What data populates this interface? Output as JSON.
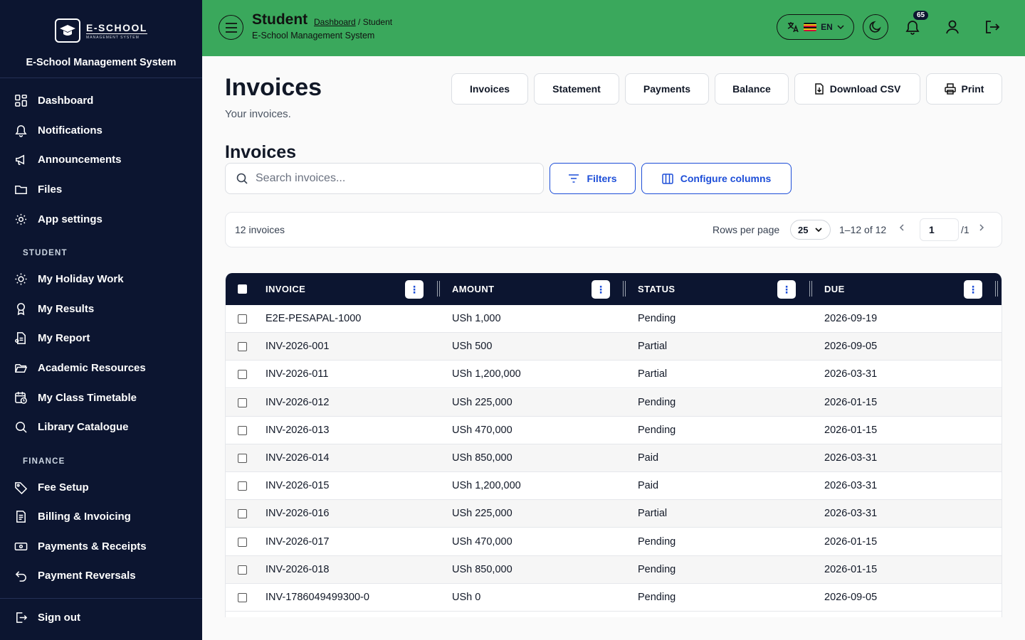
{
  "sidebar": {
    "logo_text": "E-SCHOOL",
    "logo_sub": "MANAGEMENT SYSTEM",
    "brand_title": "E-School Management System",
    "items": [
      {
        "label": "Dashboard",
        "icon": "dashboard-icon"
      },
      {
        "label": "Notifications",
        "icon": "bell-icon"
      },
      {
        "label": "Announcements",
        "icon": "megaphone-icon"
      },
      {
        "label": "Files",
        "icon": "folder-icon"
      },
      {
        "label": "App settings",
        "icon": "gear-icon"
      }
    ],
    "section_student": "STUDENT",
    "student_items": [
      {
        "label": "My Holiday Work",
        "icon": "sun-icon"
      },
      {
        "label": "My Results",
        "icon": "award-icon"
      },
      {
        "label": "My Report",
        "icon": "report-icon"
      },
      {
        "label": "Academic Resources",
        "icon": "folder-open-icon"
      },
      {
        "label": "My Class Timetable",
        "icon": "calendar-clock-icon"
      },
      {
        "label": "Library Catalogue",
        "icon": "search-icon"
      }
    ],
    "section_finance": "FINANCE",
    "finance_items": [
      {
        "label": "Fee Setup",
        "icon": "tag-icon"
      },
      {
        "label": "Billing & Invoicing",
        "icon": "invoice-icon"
      },
      {
        "label": "Payments & Receipts",
        "icon": "banknote-icon"
      },
      {
        "label": "Payment Reversals",
        "icon": "undo-icon"
      }
    ],
    "sign_out": "Sign out"
  },
  "header": {
    "title": "Student",
    "breadcrumb_link": "Dashboard",
    "breadcrumb_current": " / Student",
    "subtitle": "E-School Management System",
    "language": "EN",
    "notification_count": "65"
  },
  "page": {
    "title": "Invoices",
    "subtitle": "Your invoices.",
    "tabs": [
      "Invoices",
      "Statement",
      "Payments",
      "Balance"
    ],
    "download_label": "Download CSV",
    "print_label": "Print",
    "section_title": "Invoices",
    "search_placeholder": "Search invoices...",
    "filters_label": "Filters",
    "configure_label": "Configure columns"
  },
  "pager": {
    "count": "12 invoices",
    "rows_per_page_label": "Rows per page",
    "rows_per_page": "25",
    "range": "1–12 of 12",
    "page": "1",
    "total_pages": "/1"
  },
  "table": {
    "columns": [
      "INVOICE",
      "AMOUNT",
      "STATUS",
      "DUE"
    ],
    "rows": [
      [
        "E2E-PESAPAL-1000",
        "USh 1,000",
        "Pending",
        "2026-09-19"
      ],
      [
        "INV-2026-001",
        "USh 500",
        "Partial",
        "2026-09-05"
      ],
      [
        "INV-2026-011",
        "USh 1,200,000",
        "Partial",
        "2026-03-31"
      ],
      [
        "INV-2026-012",
        "USh 225,000",
        "Pending",
        "2026-01-15"
      ],
      [
        "INV-2026-013",
        "USh 470,000",
        "Pending",
        "2026-01-15"
      ],
      [
        "INV-2026-014",
        "USh 850,000",
        "Paid",
        "2026-03-31"
      ],
      [
        "INV-2026-015",
        "USh 1,200,000",
        "Paid",
        "2026-03-31"
      ],
      [
        "INV-2026-016",
        "USh 225,000",
        "Partial",
        "2026-03-31"
      ],
      [
        "INV-2026-017",
        "USh 470,000",
        "Pending",
        "2026-01-15"
      ],
      [
        "INV-2026-018",
        "USh 850,000",
        "Pending",
        "2026-01-15"
      ],
      [
        "INV-1786049499300-0",
        "USh 0",
        "Pending",
        "2026-09-05"
      ]
    ]
  },
  "colors": {
    "sidebar_bg": "#0c1530",
    "header_bg": "#3aa85c",
    "accent": "#1d4ed8"
  }
}
